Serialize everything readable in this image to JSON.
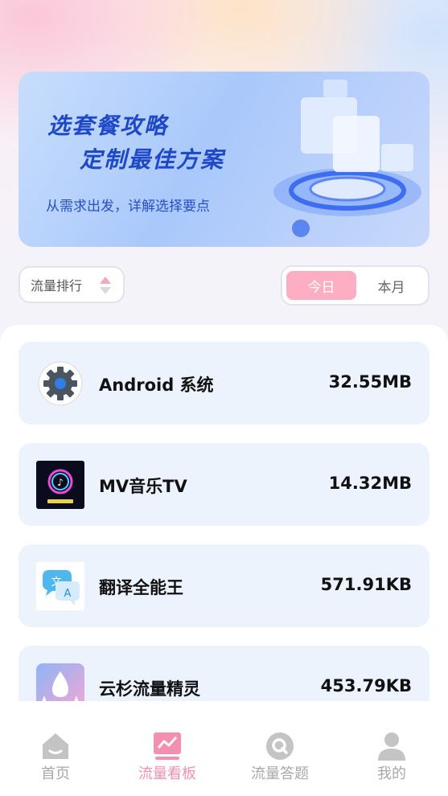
{
  "banner": {
    "title_line1": "选套餐攻略",
    "title_line2": "定制最佳方案",
    "subtitle": "从需求出发，详解选择要点"
  },
  "controls": {
    "sort_label": "流量排行",
    "period_options": [
      "今日",
      "本月"
    ],
    "period_selected": "今日"
  },
  "apps": [
    {
      "name": "Android 系统",
      "usage": "32.55MB",
      "icon": "gear-icon"
    },
    {
      "name": "MV音乐TV",
      "usage": "14.32MB",
      "icon": "music-tv-icon"
    },
    {
      "name": "翻译全能王",
      "usage": "571.91KB",
      "icon": "translate-icon"
    },
    {
      "name": "云杉流量精灵",
      "usage": "453.79KB",
      "icon": "droplet-icon"
    }
  ],
  "tabs": [
    {
      "label": "首页",
      "icon": "home-icon",
      "active": false
    },
    {
      "label": "流量看板",
      "icon": "chart-board-icon",
      "active": true
    },
    {
      "label": "流量答题",
      "icon": "quiz-icon",
      "active": false
    },
    {
      "label": "我的",
      "icon": "profile-icon",
      "active": false
    }
  ],
  "colors": {
    "accent_pink": "#f58fb0",
    "segment_active": "#fdaec3",
    "banner_text": "#1f48c8",
    "card_bg": "#edf3fc"
  }
}
